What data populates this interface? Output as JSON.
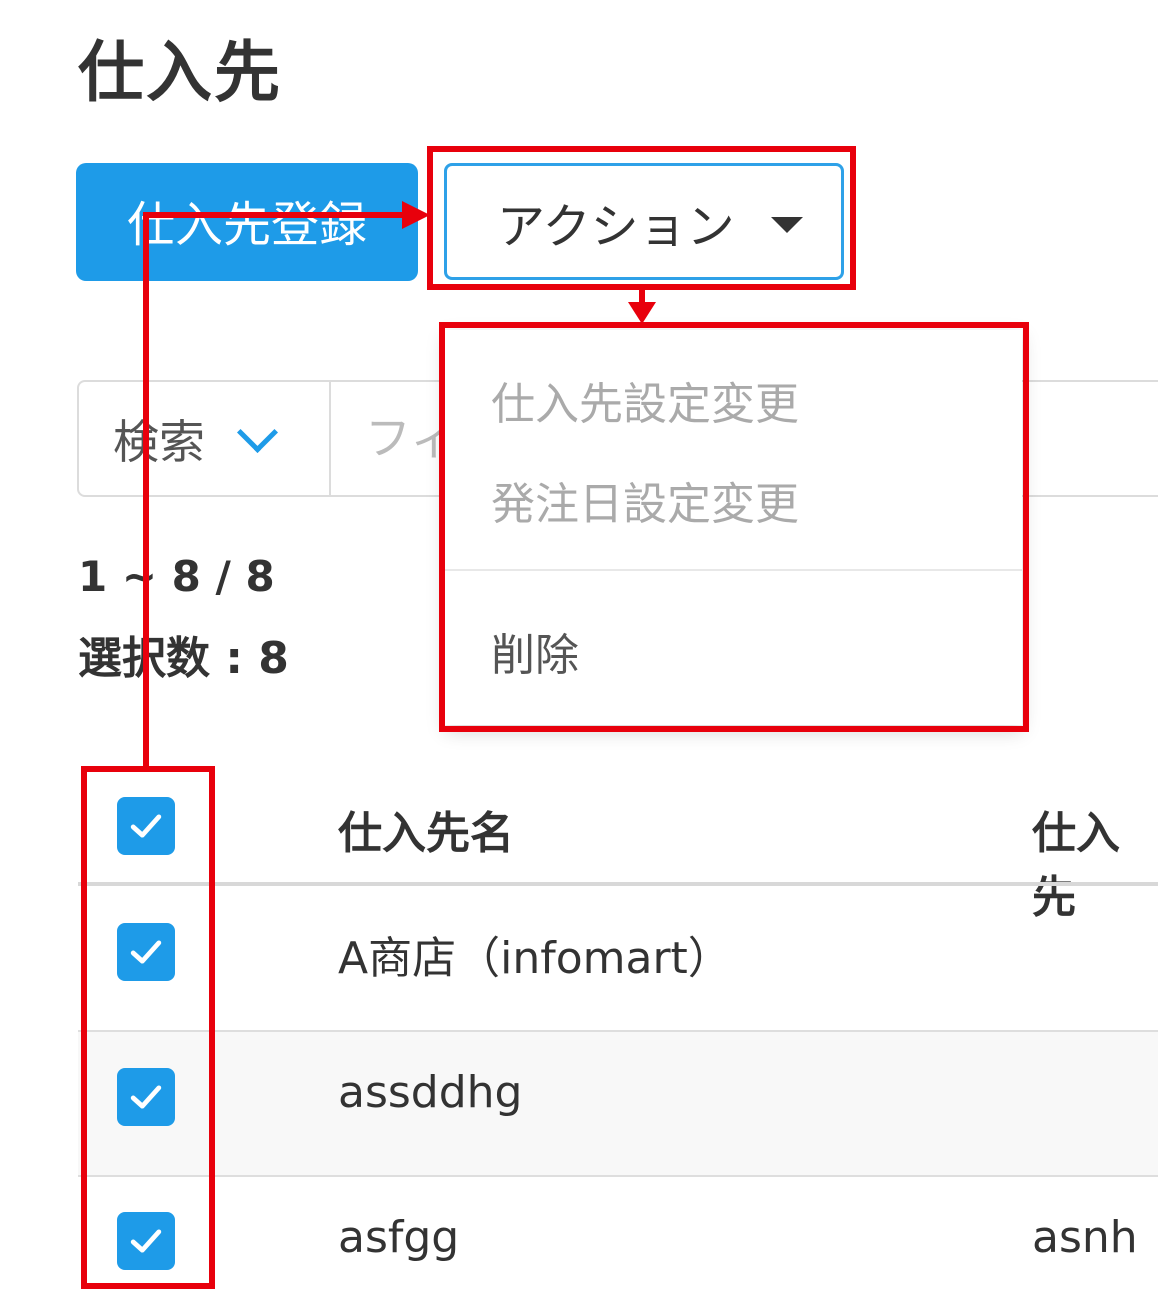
{
  "page": {
    "title": "仕入先"
  },
  "toolbar": {
    "register_label": "仕入先登録",
    "action_label": "アクション"
  },
  "action_menu": {
    "items": [
      {
        "label": "仕入先設定変更",
        "enabled": false
      },
      {
        "label": "発注日設定変更",
        "enabled": false
      },
      {
        "label": "削除",
        "enabled": true
      }
    ]
  },
  "search": {
    "type_label": "検索",
    "placeholder": "フィ"
  },
  "summary": {
    "count": "1 ~ 8 / 8",
    "selected": "選択数 : 8"
  },
  "table": {
    "columns": [
      "仕入先名",
      "仕入先"
    ],
    "rows": [
      {
        "name": "A商店（infomart）",
        "code": "",
        "checked": true
      },
      {
        "name": "assddhg",
        "code": "",
        "checked": true
      },
      {
        "name": "asfgg",
        "code": "asnh",
        "checked": true
      }
    ],
    "header_checked": true
  },
  "colors": {
    "primary": "#1e9be8",
    "annotation": "#e8000c",
    "text": "#333333"
  }
}
